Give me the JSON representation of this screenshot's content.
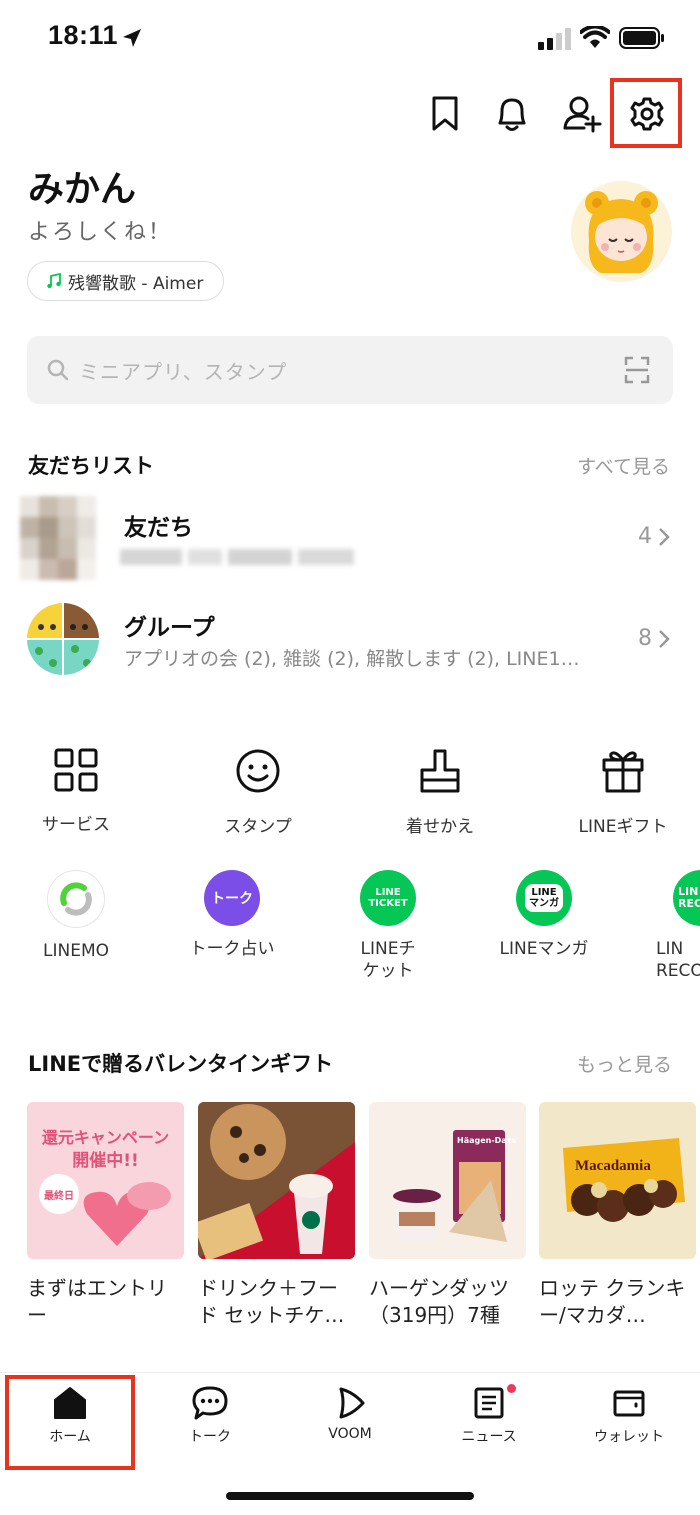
{
  "status_bar": {
    "time": "18:11"
  },
  "profile": {
    "name": "みかん",
    "status_message": "よろしくね！",
    "music": "残響散歌 - Aimer"
  },
  "search": {
    "placeholder": "ミニアプリ、スタンプ"
  },
  "friends_section": {
    "title": "友だちリスト",
    "see_all": "すべて見る",
    "rows": [
      {
        "title": "友だち",
        "count": "4"
      },
      {
        "title": "グループ",
        "subtitle": "アプリオの会 (2), 雑談 (2), 解散します (2), LINE1…",
        "count": "8"
      }
    ]
  },
  "services": [
    {
      "label": "サービス",
      "icon": "grid-icon"
    },
    {
      "label": "スタンプ",
      "icon": "smiley-icon"
    },
    {
      "label": "着せかえ",
      "icon": "brush-icon"
    },
    {
      "label": "LINEギフト",
      "icon": "gift-icon"
    }
  ],
  "apps": [
    {
      "label": "LINEMO",
      "icon_text": ""
    },
    {
      "label": "トーク占い",
      "icon_text": "トーク"
    },
    {
      "label": "LINEチ\nケット",
      "icon_text": "LINE\nTICKET"
    },
    {
      "label": "LINEマンガ",
      "icon_text": "LINE\nマンガ"
    },
    {
      "label": "LIN\nRECO",
      "icon_text": "LIN\nRECO"
    }
  ],
  "gift_section": {
    "title": "LINEで贈るバレンタインギフト",
    "more": "もっと見る",
    "cards": [
      {
        "title": "まずはエントリー",
        "img_text1": "還元キャンペーン",
        "img_text2": "開催中!!",
        "badge": "最終日"
      },
      {
        "title": "ドリンク＋フード セットチケ…"
      },
      {
        "title": "ハーゲンダッツ（319円）7種",
        "brand": "Häagen-Dazs"
      },
      {
        "title": "ロッテ クランキー/マカダ…",
        "brand": "Macadamia"
      }
    ]
  },
  "tabbar": {
    "tabs": [
      {
        "label": "ホーム"
      },
      {
        "label": "トーク"
      },
      {
        "label": "VOOM"
      },
      {
        "label": "ニュース"
      },
      {
        "label": "ウォレット"
      }
    ]
  },
  "colors": {
    "highlight": "#e8331e",
    "line_green": "#06c755",
    "purple": "#7b4ee8"
  }
}
